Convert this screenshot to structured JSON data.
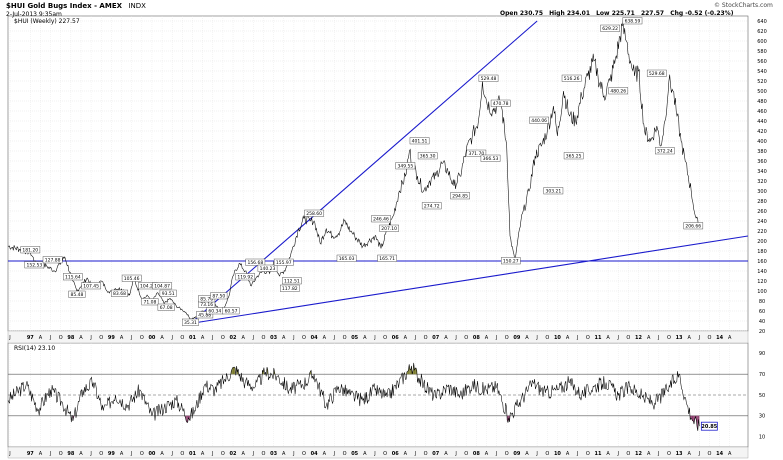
{
  "header": {
    "title": "$HUI Gold Bugs Index - AMEX",
    "subtitle": "INDX",
    "date": "2-Jul-2013 9:35am",
    "quote": {
      "open_label": "Open",
      "open": "230.75",
      "high_label": "High",
      "high": "234.01",
      "low_label": "Low",
      "low": "225.71",
      "last": "227.57",
      "chg_label": "Chg",
      "chg": "-0.52 (-0.23%)"
    },
    "watermark": "© StockCharts.com"
  },
  "chart_data": [
    {
      "type": "line",
      "legend": "$HUI (Weekly) 227.57",
      "ylim": [
        20,
        650
      ],
      "yticks": [
        20,
        40,
        60,
        80,
        100,
        120,
        140,
        160,
        180,
        200,
        220,
        240,
        260,
        280,
        300,
        320,
        340,
        360,
        380,
        400,
        420,
        440,
        460,
        480,
        500,
        520,
        540,
        560,
        580,
        600,
        620,
        640
      ],
      "xlim": [
        1996.45,
        2014.7
      ],
      "xticks": [
        {
          "x": 1996.5,
          "label": "J"
        },
        {
          "x": 1997.0,
          "label": "97"
        },
        {
          "x": 1997.25,
          "label": "A"
        },
        {
          "x": 1997.5,
          "label": "J"
        },
        {
          "x": 1997.75,
          "label": "O"
        },
        {
          "x": 1998.0,
          "label": "98"
        },
        {
          "x": 1998.25,
          "label": "A"
        },
        {
          "x": 1998.5,
          "label": "J"
        },
        {
          "x": 1998.75,
          "label": "O"
        },
        {
          "x": 1999.0,
          "label": "99"
        },
        {
          "x": 1999.25,
          "label": "A"
        },
        {
          "x": 1999.5,
          "label": "J"
        },
        {
          "x": 1999.75,
          "label": "O"
        },
        {
          "x": 2000.0,
          "label": "00"
        },
        {
          "x": 2000.25,
          "label": "A"
        },
        {
          "x": 2000.5,
          "label": "J"
        },
        {
          "x": 2000.75,
          "label": "O"
        },
        {
          "x": 2001.0,
          "label": "01"
        },
        {
          "x": 2001.25,
          "label": "A"
        },
        {
          "x": 2001.5,
          "label": "J"
        },
        {
          "x": 2001.75,
          "label": "O"
        },
        {
          "x": 2002.0,
          "label": "02"
        },
        {
          "x": 2002.25,
          "label": "A"
        },
        {
          "x": 2002.5,
          "label": "J"
        },
        {
          "x": 2002.75,
          "label": "O"
        },
        {
          "x": 2003.0,
          "label": "03"
        },
        {
          "x": 2003.25,
          "label": "A"
        },
        {
          "x": 2003.5,
          "label": "J"
        },
        {
          "x": 2003.75,
          "label": "O"
        },
        {
          "x": 2004.0,
          "label": "04"
        },
        {
          "x": 2004.25,
          "label": "A"
        },
        {
          "x": 2004.5,
          "label": "J"
        },
        {
          "x": 2004.75,
          "label": "O"
        },
        {
          "x": 2005.0,
          "label": "05"
        },
        {
          "x": 2005.25,
          "label": "A"
        },
        {
          "x": 2005.5,
          "label": "J"
        },
        {
          "x": 2005.75,
          "label": "O"
        },
        {
          "x": 2006.0,
          "label": "06"
        },
        {
          "x": 2006.25,
          "label": "A"
        },
        {
          "x": 2006.5,
          "label": "J"
        },
        {
          "x": 2006.75,
          "label": "O"
        },
        {
          "x": 2007.0,
          "label": "07"
        },
        {
          "x": 2007.25,
          "label": "A"
        },
        {
          "x": 2007.5,
          "label": "J"
        },
        {
          "x": 2007.75,
          "label": "O"
        },
        {
          "x": 2008.0,
          "label": "08"
        },
        {
          "x": 2008.25,
          "label": "A"
        },
        {
          "x": 2008.5,
          "label": "J"
        },
        {
          "x": 2008.75,
          "label": "O"
        },
        {
          "x": 2009.0,
          "label": "09"
        },
        {
          "x": 2009.25,
          "label": "A"
        },
        {
          "x": 2009.5,
          "label": "J"
        },
        {
          "x": 2009.75,
          "label": "O"
        },
        {
          "x": 2010.0,
          "label": "10"
        },
        {
          "x": 2010.25,
          "label": "A"
        },
        {
          "x": 2010.5,
          "label": "J"
        },
        {
          "x": 2010.75,
          "label": "O"
        },
        {
          "x": 2011.0,
          "label": "11"
        },
        {
          "x": 2011.25,
          "label": "A"
        },
        {
          "x": 2011.5,
          "label": "J"
        },
        {
          "x": 2011.75,
          "label": "O"
        },
        {
          "x": 2012.0,
          "label": "12"
        },
        {
          "x": 2012.25,
          "label": "A"
        },
        {
          "x": 2012.5,
          "label": "J"
        },
        {
          "x": 2012.75,
          "label": "O"
        },
        {
          "x": 2013.0,
          "label": "13"
        },
        {
          "x": 2013.25,
          "label": "A"
        },
        {
          "x": 2013.5,
          "label": "J"
        },
        {
          "x": 2013.75,
          "label": "O"
        },
        {
          "x": 2014.0,
          "label": "14"
        },
        {
          "x": 2014.25,
          "label": "A"
        }
      ],
      "series": [
        {
          "color": "#000000",
          "x": [
            1996.45,
            1996.75,
            1997.0,
            1997.15,
            1997.4,
            1997.6,
            1997.85,
            1998.05,
            1998.15,
            1998.4,
            1998.55,
            1998.75,
            1998.95,
            1999.1,
            1999.25,
            1999.45,
            1999.55,
            1999.75,
            1999.9,
            2000.0,
            2000.15,
            2000.3,
            2000.45,
            2000.6,
            2000.75,
            2000.85,
            2000.95,
            2001.1,
            2001.25,
            2001.4,
            2001.5,
            2001.6,
            2001.75,
            2001.9,
            2002.0,
            2002.15,
            2002.3,
            2002.45,
            2002.6,
            2002.75,
            2002.9,
            2003.0,
            2003.15,
            2003.3,
            2003.45,
            2003.6,
            2003.75,
            2003.9,
            2004.0,
            2004.15,
            2004.3,
            2004.45,
            2004.6,
            2004.75,
            2004.9,
            2005.0,
            2005.2,
            2005.35,
            2005.5,
            2005.65,
            2005.8,
            2005.95,
            2006.1,
            2006.25,
            2006.35,
            2006.45,
            2006.55,
            2006.7,
            2006.85,
            2007.0,
            2007.15,
            2007.3,
            2007.45,
            2007.6,
            2007.75,
            2007.9,
            2008.05,
            2008.15,
            2008.25,
            2008.4,
            2008.5,
            2008.6,
            2008.75,
            2008.83,
            2008.95,
            2009.1,
            2009.3,
            2009.45,
            2009.6,
            2009.75,
            2009.9,
            2010.0,
            2010.15,
            2010.3,
            2010.45,
            2010.6,
            2010.75,
            2010.9,
            2011.0,
            2011.15,
            2011.3,
            2011.45,
            2011.6,
            2011.7,
            2011.8,
            2011.9,
            2012.0,
            2012.15,
            2012.3,
            2012.45,
            2012.55,
            2012.65,
            2012.75,
            2012.85,
            2012.95,
            2013.05,
            2013.15,
            2013.3,
            2013.4,
            2013.5
          ],
          "values": [
            190,
            183,
            178,
            152,
            150,
            140,
            168,
            120,
            100,
            126,
            105,
            120,
            96,
            105,
            104,
            92,
            125,
            85,
            90,
            80,
            96,
            75,
            85,
            70,
            62,
            56,
            44,
            48,
            60,
            58,
            75,
            70,
            60,
            90,
            130,
            155,
            140,
            110,
            130,
            140,
            135,
            158,
            130,
            145,
            180,
            220,
            245,
            240,
            240,
            195,
            225,
            210,
            215,
            240,
            220,
            210,
            190,
            200,
            210,
            185,
            220,
            250,
            300,
            330,
            380,
            350,
            330,
            300,
            320,
            330,
            355,
            340,
            310,
            330,
            380,
            410,
            440,
            520,
            480,
            460,
            470,
            480,
            390,
            210,
            160,
            240,
            300,
            370,
            390,
            420,
            470,
            410,
            500,
            450,
            440,
            490,
            530,
            560,
            530,
            490,
            520,
            570,
            630,
            600,
            560,
            530,
            540,
            420,
            400,
            430,
            390,
            440,
            520,
            500,
            450,
            400,
            360,
            300,
            250,
            228
          ]
        }
      ],
      "annotations": [
        {
          "x": 1997.0,
          "y": 182,
          "label": "181.20"
        },
        {
          "x": 1997.1,
          "y": 152,
          "label": "152.53"
        },
        {
          "x": 1997.55,
          "y": 162,
          "label": "127.88"
        },
        {
          "x": 1998.05,
          "y": 128,
          "label": "115.64"
        },
        {
          "x": 1998.15,
          "y": 93,
          "label": "85.48"
        },
        {
          "x": 1998.5,
          "y": 110,
          "label": "107.45"
        },
        {
          "x": 1999.2,
          "y": 95,
          "label": "83.68"
        },
        {
          "x": 1999.5,
          "y": 125,
          "label": "105.46"
        },
        {
          "x": 1999.9,
          "y": 110,
          "label": "104.20"
        },
        {
          "x": 1999.95,
          "y": 78,
          "label": "71.08"
        },
        {
          "x": 2000.25,
          "y": 110,
          "label": "104.87"
        },
        {
          "x": 2000.4,
          "y": 95,
          "label": "93.51"
        },
        {
          "x": 2000.35,
          "y": 67,
          "label": "67.08"
        },
        {
          "x": 2000.95,
          "y": 37,
          "label": "35.31"
        },
        {
          "x": 2001.3,
          "y": 52,
          "label": "45.88"
        },
        {
          "x": 2001.35,
          "y": 73,
          "label": "73.16"
        },
        {
          "x": 2001.35,
          "y": 84,
          "label": "85.76"
        },
        {
          "x": 2001.65,
          "y": 90,
          "label": "87.50"
        },
        {
          "x": 2001.55,
          "y": 60,
          "label": "60.34"
        },
        {
          "x": 2001.95,
          "y": 60,
          "label": "60.57"
        },
        {
          "x": 2002.3,
          "y": 128,
          "label": "119.92"
        },
        {
          "x": 2002.55,
          "y": 157,
          "label": "156.68"
        },
        {
          "x": 2002.85,
          "y": 145,
          "label": "140.23"
        },
        {
          "x": 2003.25,
          "y": 157,
          "label": "155.97"
        },
        {
          "x": 2003.45,
          "y": 120,
          "label": "112.51"
        },
        {
          "x": 2003.4,
          "y": 105,
          "label": "117.82"
        },
        {
          "x": 2004.0,
          "y": 255,
          "label": "258.60"
        },
        {
          "x": 2004.8,
          "y": 165,
          "label": "165.03"
        },
        {
          "x": 2005.65,
          "y": 244,
          "label": "246.46"
        },
        {
          "x": 2005.85,
          "y": 225,
          "label": "207.10"
        },
        {
          "x": 2005.8,
          "y": 165,
          "label": "165.71"
        },
        {
          "x": 2006.25,
          "y": 350,
          "label": "349.55"
        },
        {
          "x": 2006.6,
          "y": 400,
          "label": "401.51"
        },
        {
          "x": 2006.8,
          "y": 370,
          "label": "365.30"
        },
        {
          "x": 2006.9,
          "y": 270,
          "label": "274.72"
        },
        {
          "x": 2007.6,
          "y": 290,
          "label": "294.85"
        },
        {
          "x": 2008.0,
          "y": 375,
          "label": "371.70"
        },
        {
          "x": 2008.3,
          "y": 525,
          "label": "529.48"
        },
        {
          "x": 2008.35,
          "y": 365,
          "label": "366.53"
        },
        {
          "x": 2008.6,
          "y": 475,
          "label": "470.78"
        },
        {
          "x": 2008.85,
          "y": 160,
          "label": "150.27"
        },
        {
          "x": 2009.55,
          "y": 441,
          "label": "440.06"
        },
        {
          "x": 2009.9,
          "y": 300,
          "label": "303.21"
        },
        {
          "x": 2010.35,
          "y": 525,
          "label": "516.26"
        },
        {
          "x": 2010.4,
          "y": 370,
          "label": "365.25"
        },
        {
          "x": 2011.3,
          "y": 625,
          "label": "629.22"
        },
        {
          "x": 2011.5,
          "y": 500,
          "label": "480.26"
        },
        {
          "x": 2011.85,
          "y": 640,
          "label": "638.59"
        },
        {
          "x": 2012.45,
          "y": 535,
          "label": "529.68"
        },
        {
          "x": 2012.65,
          "y": 380,
          "label": "372.24"
        },
        {
          "x": 2013.35,
          "y": 230,
          "label": "206.66"
        }
      ],
      "trendlines": [
        {
          "x1": 2000.95,
          "y1": 35,
          "x2": 2009.5,
          "y2": 640
        },
        {
          "x1": 2000.95,
          "y1": 35,
          "x2": 2014.7,
          "y2": 210
        },
        {
          "x1": 1996.45,
          "y1": 160,
          "x2": 2014.7,
          "y2": 160
        }
      ]
    },
    {
      "type": "line",
      "legend": "RSI(14) 23.10",
      "ylim": [
        0,
        100
      ],
      "yticks": [
        10,
        30,
        50,
        70,
        90
      ],
      "ref_lines": [
        70,
        50,
        30
      ],
      "overbought": 70,
      "oversold": 30,
      "series": [
        {
          "color": "#000000",
          "x": [
            1996.45,
            1996.9,
            1997.2,
            1997.5,
            1997.8,
            1998.05,
            1998.3,
            1998.55,
            1998.8,
            1999.1,
            1999.4,
            1999.7,
            2000.0,
            2000.3,
            2000.6,
            2000.9,
            2001.05,
            2001.3,
            2001.55,
            2001.8,
            2002.05,
            2002.3,
            2002.55,
            2002.8,
            2003.1,
            2003.4,
            2003.7,
            2004.0,
            2004.3,
            2004.6,
            2004.9,
            2005.2,
            2005.5,
            2005.8,
            2006.1,
            2006.4,
            2006.7,
            2007.0,
            2007.3,
            2007.6,
            2007.9,
            2008.2,
            2008.5,
            2008.8,
            2009.1,
            2009.4,
            2009.7,
            2010.0,
            2010.3,
            2010.6,
            2010.9,
            2011.2,
            2011.5,
            2011.8,
            2012.1,
            2012.4,
            2012.7,
            2013.0,
            2013.2,
            2013.35,
            2013.5
          ],
          "values": [
            45,
            60,
            36,
            55,
            42,
            25,
            55,
            62,
            35,
            50,
            40,
            55,
            30,
            38,
            45,
            28,
            35,
            60,
            55,
            65,
            76,
            62,
            58,
            72,
            68,
            55,
            60,
            70,
            40,
            58,
            50,
            45,
            55,
            48,
            62,
            78,
            60,
            48,
            58,
            50,
            60,
            55,
            58,
            28,
            45,
            62,
            52,
            55,
            62,
            50,
            58,
            62,
            50,
            58,
            48,
            42,
            55,
            70,
            40,
            25,
            20
          ]
        }
      ],
      "value_tag": "20.85"
    }
  ]
}
